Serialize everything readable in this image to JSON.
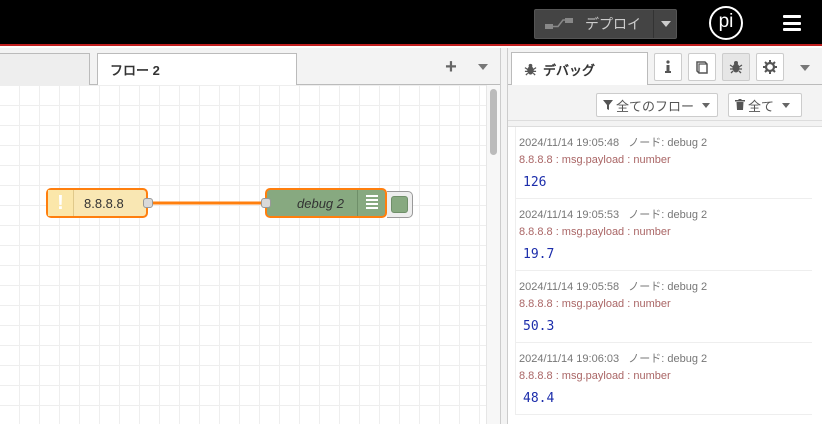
{
  "header": {
    "deploy_label": "デプロイ",
    "logo_text": "pi"
  },
  "workspace": {
    "tabs": [
      {
        "label": ""
      },
      {
        "label": "フロー 2",
        "active": true
      }
    ],
    "add_tab_label": "+"
  },
  "nodes": {
    "inject": {
      "label": "8.8.8.8",
      "warning": "!"
    },
    "debug": {
      "label": "debug 2"
    }
  },
  "sidebar": {
    "active_tab": "デバッグ",
    "buttons": [
      "info-icon",
      "book-icon",
      "bug-icon",
      "gear-icon"
    ],
    "filter_label": "全てのフロー",
    "clear_label": "全て"
  },
  "messages": [
    {
      "meta": "2024/11/14 19:05:48   ノード: debug 2",
      "topic": "8.8.8.8 : msg.payload : number",
      "value": "126"
    },
    {
      "meta": "2024/11/14 19:05:53   ノード: debug 2",
      "topic": "8.8.8.8 : msg.payload : number",
      "value": "19.7"
    },
    {
      "meta": "2024/11/14 19:05:58   ノード: debug 2",
      "topic": "8.8.8.8 : msg.payload : number",
      "value": "50.3"
    },
    {
      "meta": "2024/11/14 19:06:03   ノード: debug 2",
      "topic": "8.8.8.8 : msg.payload : number",
      "value": "48.4"
    }
  ],
  "colors": {
    "header_bg": "#000000",
    "header_accent": "#c02020",
    "node_selected_border": "#ff7f0e",
    "inject_node_bg": "#f9e7b3",
    "debug_node_bg": "#87a980",
    "wire": "#ff7f0e",
    "msg_value": "#1c2dab",
    "msg_topic": "#aa6666"
  }
}
